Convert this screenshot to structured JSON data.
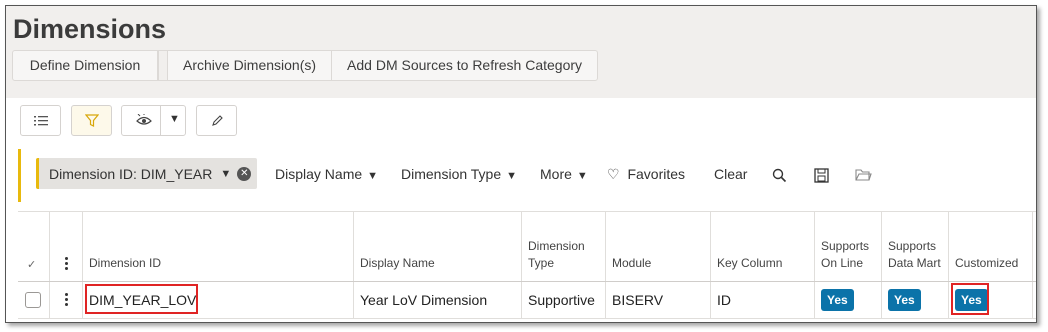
{
  "page": {
    "title": "Dimensions"
  },
  "commands": [
    {
      "label": "Define Dimension"
    },
    {
      "label": "Archive Dimension(s)"
    },
    {
      "label": "Add DM Sources to Refresh Category"
    }
  ],
  "toolbar": {
    "buttons": [
      "list-icon",
      "filter-icon",
      "view-eye-icon",
      "dropdown-caret-icon",
      "edit-pencil-icon"
    ]
  },
  "filter_bar": {
    "chip_label": "Dimension ID: DIM_YEAR",
    "display_name": "Display Name",
    "dimension_type": "Dimension Type",
    "more": "More",
    "favorites": "Favorites",
    "clear": "Clear",
    "icons": [
      "search-icon",
      "save-icon",
      "folder-icon"
    ]
  },
  "table": {
    "columns": [
      "Dimension ID",
      "Display Name",
      "Dimension Type",
      "Module",
      "Key Column",
      "Supports On Line",
      "Supports Data Mart",
      "Customized"
    ],
    "rows": [
      {
        "dimension_id": "DIM_YEAR_LOV",
        "display_name": "Year LoV Dimension",
        "dimension_type": "Supportive",
        "module": "BISERV",
        "key_column": "ID",
        "supports_on_line": "Yes",
        "supports_data_mart": "Yes",
        "customized": "Yes"
      }
    ]
  },
  "colors": {
    "accent_yellow": "#e8b90d",
    "yes_badge": "#0b73a9",
    "highlight_red": "#e02424",
    "header_bg": "#f1efed"
  }
}
